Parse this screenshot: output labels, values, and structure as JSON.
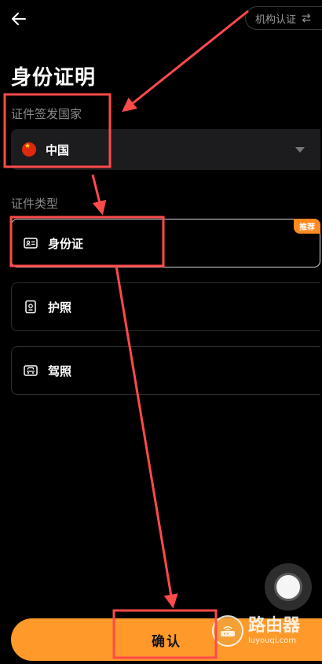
{
  "header": {
    "back_icon": "arrow-left-icon",
    "org_switch_label": "机构认证",
    "org_switch_icon": "swap-icon"
  },
  "page": {
    "title": "身份证明"
  },
  "country": {
    "label": "证件签发国家",
    "value": "中国",
    "flag_icon": "china-flag-icon"
  },
  "doc_types": {
    "label": "证件类型",
    "items": [
      {
        "name": "身份证",
        "icon": "id-card-icon",
        "badge": "推荐",
        "selected": true
      },
      {
        "name": "护照",
        "icon": "passport-icon"
      },
      {
        "name": "驾照",
        "icon": "driver-license-icon"
      }
    ]
  },
  "footer": {
    "confirm_label": "确认"
  },
  "watermark": {
    "cn": "路由器",
    "en": "luyouqi.com"
  },
  "colors": {
    "accent": "#ff9a2a",
    "annotation": "#ff4a4a",
    "background": "#000000"
  }
}
